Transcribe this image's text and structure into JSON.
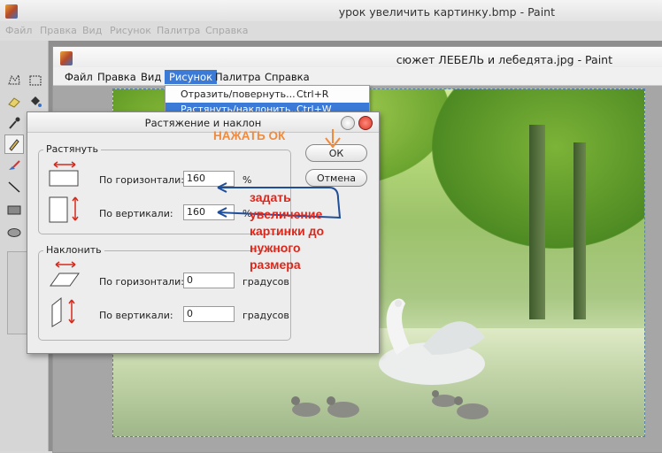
{
  "outer_window": {
    "title": "урок увеличить картинку.bmp - Paint",
    "menu": [
      "Файл",
      "Правка",
      "Вид",
      "Рисунок",
      "Палитра",
      "Справка"
    ]
  },
  "inner_window": {
    "title": "сюжет ЛЕБЕЛЬ и лебедята.jpg - Paint",
    "menu": [
      "Файл",
      "Правка",
      "Вид",
      "Рисунок",
      "Палитра",
      "Справка"
    ],
    "active_menu": "Рисунок"
  },
  "dropdown": {
    "items": [
      {
        "label": "Отразить/повернуть...",
        "shortcut": "Ctrl+R"
      },
      {
        "label": "Растянуть/наклонить...",
        "shortcut": "Ctrl+W"
      }
    ]
  },
  "dialog": {
    "title": "Растяжение и наклон",
    "stretch": {
      "label": "Растянуть",
      "horizontal_label": "По горизонтали:",
      "horizontal_value": "160",
      "horizontal_unit": "%",
      "vertical_label": "По вертикали:",
      "vertical_value": "160",
      "vertical_unit": "%"
    },
    "skew": {
      "label": "Наклонить",
      "horizontal_label": "По горизонтали:",
      "horizontal_value": "0",
      "horizontal_unit": "градусов",
      "vertical_label": "По вертикали:",
      "vertical_value": "0",
      "vertical_unit": "градусов"
    },
    "ok_label": "ОК",
    "cancel_label": "Отмена"
  },
  "annotations": {
    "press_ok": "НАЖАТЬ ОК",
    "instruction_lines": [
      "задать",
      "увеличение",
      "картинки до",
      "нужного",
      "размера"
    ],
    "instruction_color": "#e0261a",
    "press_ok_color": "#f08a3c",
    "arrow_color": "#1f4e9a"
  },
  "colors": {
    "menu_highlight": "#3b7ad6",
    "close_button": "#d9372b"
  },
  "icons": [
    "app-icon",
    "select-icon",
    "eraser-icon",
    "fill-icon",
    "eyedropper-icon",
    "pencil-icon",
    "brush-icon",
    "line-icon",
    "rectangle-icon",
    "ellipse-icon",
    "minimize-icon",
    "close-icon",
    "arrow-horizontal-icon",
    "arrow-vertical-icon"
  ]
}
